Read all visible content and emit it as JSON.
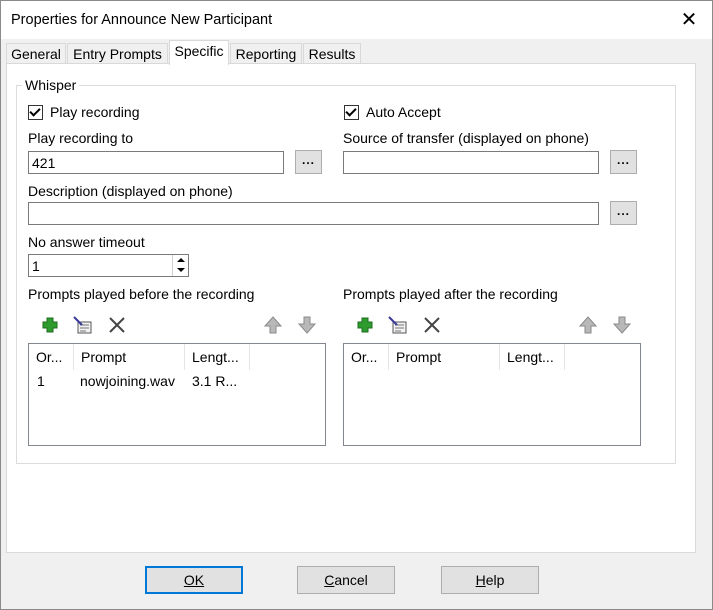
{
  "window": {
    "title": "Properties for Announce New Participant"
  },
  "tabs": [
    {
      "label": "General"
    },
    {
      "label": "Entry Prompts"
    },
    {
      "label": "Specific"
    },
    {
      "label": "Reporting"
    },
    {
      "label": "Results"
    }
  ],
  "active_tab": "Specific",
  "group": {
    "legend": "Whisper"
  },
  "play_recording": {
    "label": "Play recording",
    "checked": true
  },
  "auto_accept": {
    "label": "Auto Accept",
    "checked": true
  },
  "play_recording_to": {
    "label": "Play recording to",
    "value": "421"
  },
  "source_of_transfer": {
    "label": "Source of transfer (displayed on phone)",
    "value": ""
  },
  "description": {
    "label": "Description (displayed on phone)",
    "value": ""
  },
  "browse_label": "...",
  "no_answer_timeout": {
    "label": "No answer timeout",
    "value": "1"
  },
  "prompts_before": {
    "label": "Prompts played before the recording",
    "columns": [
      "Or...",
      "Prompt",
      "Lengt..."
    ],
    "rows": [
      {
        "order": "1",
        "prompt": "nowjoining.wav",
        "length": "3.1 R..."
      }
    ]
  },
  "prompts_after": {
    "label": "Prompts played after the recording",
    "columns": [
      "Or...",
      "Prompt",
      "Lengt..."
    ],
    "rows": []
  },
  "toolbar_icons": [
    "add-icon",
    "edit-icon",
    "delete-icon",
    "move-up-icon",
    "move-down-icon"
  ],
  "buttons": {
    "ok": {
      "label": "OK",
      "mnemonic": "O"
    },
    "cancel": {
      "label": "Cancel",
      "mnemonic": "C"
    },
    "help": {
      "label": "Help",
      "mnemonic": "H"
    }
  },
  "colors": {
    "accent": "#0078d7",
    "add_green": "#2e9b2e",
    "arrow_gray": "#9a9a9a"
  }
}
